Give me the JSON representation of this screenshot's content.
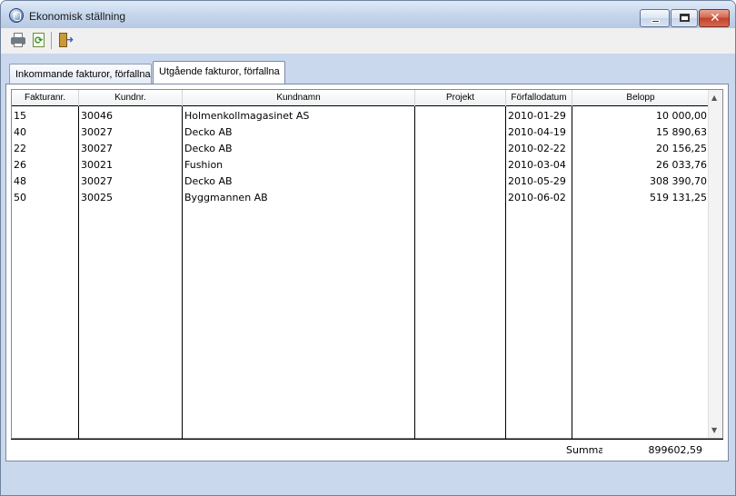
{
  "window": {
    "title": "Ekonomisk ställning",
    "controls": {
      "minimize": "minimize",
      "maximize": "maximize",
      "close": "✕"
    }
  },
  "toolbar": {
    "icons": [
      "printer-icon",
      "refresh-icon",
      "exit-icon"
    ]
  },
  "tabs": [
    {
      "label": "Inkommande fakturor, förfallna",
      "active": false
    },
    {
      "label": "Utgående fakturor, förfallna",
      "active": true
    }
  ],
  "table": {
    "columns": [
      "Fakturanr.",
      "Kundnr.",
      "Kundnamn",
      "Projekt",
      "Förfallodatum",
      "Belopp"
    ],
    "rows": [
      {
        "fakturanr": "15",
        "kundnr": "30046",
        "kundnamn": "Holmenkollmagasinet AS",
        "projekt": "",
        "forfallodatum": "2010-01-29",
        "belopp": "10 000,00"
      },
      {
        "fakturanr": "40",
        "kundnr": "30027",
        "kundnamn": "Decko AB",
        "projekt": "",
        "forfallodatum": "2010-04-19",
        "belopp": "15 890,63"
      },
      {
        "fakturanr": "22",
        "kundnr": "30027",
        "kundnamn": "Decko AB",
        "projekt": "",
        "forfallodatum": "2010-02-22",
        "belopp": "20 156,25"
      },
      {
        "fakturanr": "26",
        "kundnr": "30021",
        "kundnamn": "Fushion",
        "projekt": "",
        "forfallodatum": "2010-03-04",
        "belopp": "26 033,76"
      },
      {
        "fakturanr": "48",
        "kundnr": "30027",
        "kundnamn": "Decko AB",
        "projekt": "",
        "forfallodatum": "2010-05-29",
        "belopp": "308 390,70"
      },
      {
        "fakturanr": "50",
        "kundnr": "30025",
        "kundnamn": "Byggmannen AB",
        "projekt": "",
        "forfallodatum": "2010-06-02",
        "belopp": "519 131,25"
      }
    ]
  },
  "footer": {
    "summa_label": "Summa",
    "summa_value": "899602,59"
  }
}
